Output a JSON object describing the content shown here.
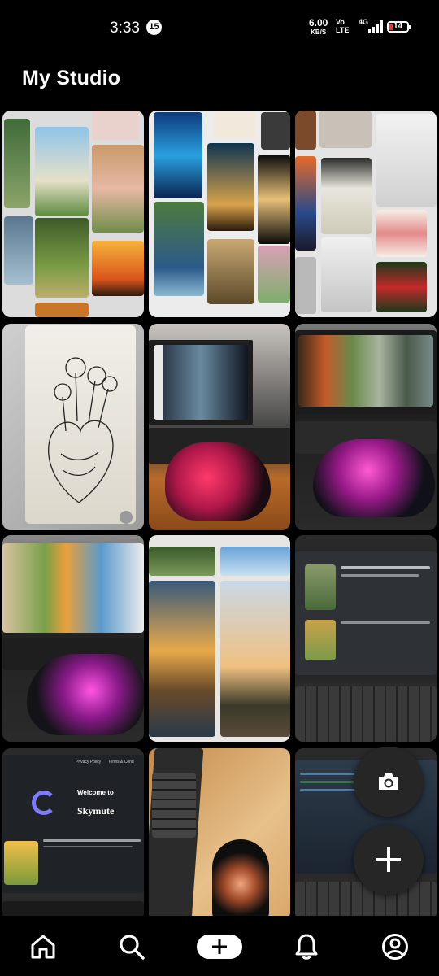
{
  "status_bar": {
    "time": "3:33",
    "notification_count": "15",
    "net_speed_value": "6.00",
    "net_speed_unit": "KB/S",
    "network_top": "Vo",
    "network_bottom": "LTE",
    "network_gen": "4G",
    "battery_level": "14",
    "battery_color": "#e53935"
  },
  "header": {
    "title": "My Studio"
  },
  "grid": {
    "columns": 3,
    "tiles": [
      {
        "name": "pin-collage-nature-1"
      },
      {
        "name": "pin-collage-art-1"
      },
      {
        "name": "pin-collage-drawings-1"
      },
      {
        "name": "pin-heart-sketch"
      },
      {
        "name": "pin-laptop-mouse-1"
      },
      {
        "name": "pin-laptop-mouse-2"
      },
      {
        "name": "pin-laptop-mouse-3"
      },
      {
        "name": "pin-sunset-boats"
      },
      {
        "name": "pin-laptop-text"
      },
      {
        "name": "pin-skymute-site"
      },
      {
        "name": "pin-keyboard-mouse"
      },
      {
        "name": "pin-laptop-code"
      }
    ]
  },
  "tile_texts": {
    "welcome_heading": "Welcome to",
    "brand_name": "Skymute",
    "menu_privacy": "Privacy Policy",
    "menu_terms": "Terms & Cond"
  },
  "fab": {
    "camera_icon": "camera-icon",
    "add_icon": "plus-icon"
  },
  "nav": {
    "items": [
      {
        "icon": "home-icon"
      },
      {
        "icon": "search-icon"
      },
      {
        "icon": "plus-icon"
      },
      {
        "icon": "bell-icon"
      },
      {
        "icon": "profile-icon"
      }
    ]
  }
}
